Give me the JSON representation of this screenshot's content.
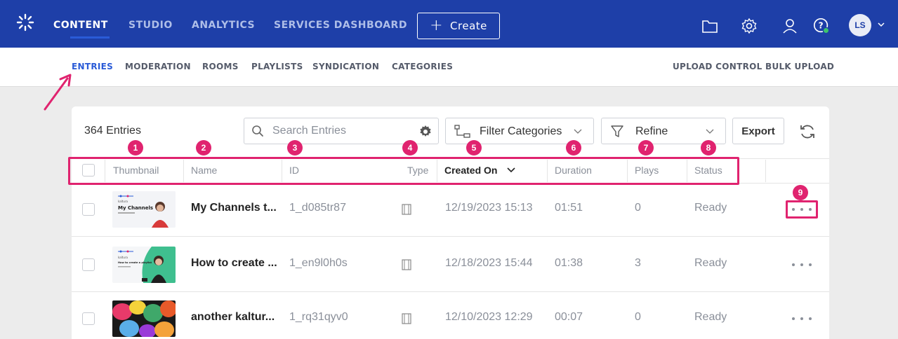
{
  "topnav": {
    "items": [
      "CONTENT",
      "STUDIO",
      "ANALYTICS",
      "SERVICES DASHBOARD"
    ],
    "create_label": "Create",
    "avatar_initials": "LS"
  },
  "subnav": {
    "left": [
      "ENTRIES",
      "MODERATION",
      "ROOMS",
      "PLAYLISTS",
      "SYNDICATION",
      "CATEGORIES"
    ],
    "right": [
      "UPLOAD CONTROL",
      "BULK UPLOAD"
    ]
  },
  "toolbar": {
    "entries_count": "364 Entries",
    "search_placeholder": "Search Entries",
    "filter_label": "Filter Categories",
    "refine_label": "Refine",
    "export_label": "Export"
  },
  "table": {
    "headers": [
      "Thumbnail",
      "Name",
      "ID",
      "Type",
      "Created On",
      "Duration",
      "Plays",
      "Status"
    ],
    "rows": [
      {
        "name": "My Channels t...",
        "id": "1_d085tr87",
        "created": "12/19/2023 15:13",
        "duration": "01:51",
        "plays": "0",
        "status": "Ready",
        "thumb_title": "My Channels"
      },
      {
        "name": "How to create ...",
        "id": "1_en9l0h0s",
        "created": "12/18/2023 15:44",
        "duration": "01:38",
        "plays": "3",
        "status": "Ready",
        "thumb_title": "How to create a playlist"
      },
      {
        "name": "another kaltur...",
        "id": "1_rq31qyv0",
        "created": "12/10/2023 12:29",
        "duration": "00:07",
        "plays": "0",
        "status": "Ready",
        "thumb_title": ""
      }
    ]
  },
  "badges": [
    "1",
    "2",
    "3",
    "4",
    "5",
    "6",
    "7",
    "8",
    "9"
  ],
  "colors": {
    "topbar": "#1e3fa8",
    "accent": "#2a5bd7",
    "annotation": "#e0236f"
  }
}
